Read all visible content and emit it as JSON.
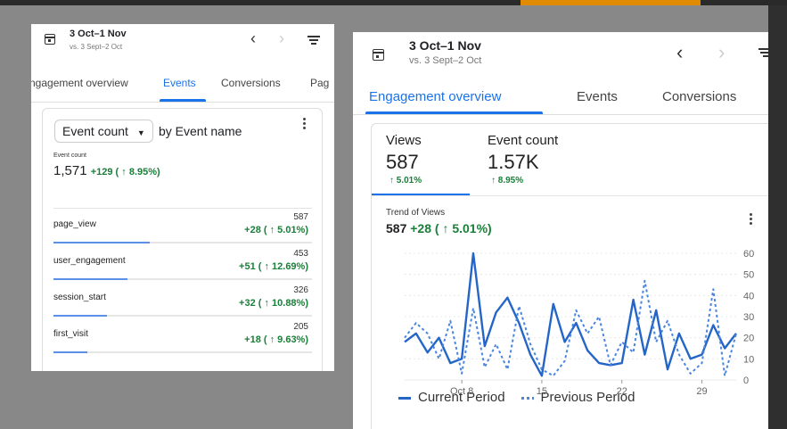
{
  "left_panel": {
    "header": {
      "date_range": "3 Oct–1 Nov",
      "comparison": "vs. 3 Sept–2 Oct",
      "prev_icon": "‹",
      "next_icon": "›"
    },
    "tabs": [
      {
        "label": "ngagement overview",
        "active": false
      },
      {
        "label": "Events",
        "active": true
      },
      {
        "label": "Conversions",
        "active": false
      },
      {
        "label": "Pag",
        "active": false
      }
    ],
    "card": {
      "metric_selector": "Event count",
      "dimension_label": "by Event name",
      "metric_label": "Event count",
      "total_value": "1,571",
      "total_delta": "+129 ( ↑ 8.95%)",
      "rows": [
        {
          "name": "page_view",
          "value": "587",
          "delta": "+28 ( ↑ 5.01%)",
          "share": 1.0
        },
        {
          "name": "user_engagement",
          "value": "453",
          "delta": "+51 ( ↑ 12.69%)",
          "share": 0.77
        },
        {
          "name": "session_start",
          "value": "326",
          "delta": "+32 ( ↑ 10.88%)",
          "share": 0.56
        },
        {
          "name": "first_visit",
          "value": "205",
          "delta": "+18 ( ↑ 9.63%)",
          "share": 0.35
        }
      ]
    }
  },
  "right_panel": {
    "header": {
      "date_range": "3 Oct–1 Nov",
      "comparison": "vs. 3 Sept–2 Oct",
      "prev_icon": "‹",
      "next_icon": "›"
    },
    "tabs": [
      {
        "label": "Engagement overview",
        "active": true
      },
      {
        "label": "Events",
        "active": false
      },
      {
        "label": "Conversions",
        "active": false
      }
    ],
    "metrics": [
      {
        "label": "Views",
        "value": "587",
        "delta": "↑ 5.01%",
        "selected": true
      },
      {
        "label": "Event count",
        "value": "1.57K",
        "delta": "↑ 8.95%",
        "selected": false
      }
    ],
    "trend": {
      "title": "Trend of Views",
      "value": "587",
      "delta": "+28 ( ↑ 5.01%)"
    },
    "legend": {
      "current": "Current Period",
      "previous": "Previous Period"
    }
  },
  "colors": {
    "accent": "#1a73e8",
    "positive": "#188038",
    "current_series": "#2466c8",
    "previous_series": "#4a86e0"
  },
  "chart_data": {
    "type": "line",
    "x_ticks": [
      "Oct 8",
      "15",
      "22",
      "29"
    ],
    "y_ticks": [
      0,
      10,
      20,
      30,
      40,
      50,
      60
    ],
    "ylim": [
      0,
      60
    ],
    "grid": true,
    "legend_position": "bottom",
    "series": [
      {
        "name": "Current Period",
        "style": "solid",
        "values": [
          18,
          22,
          13,
          20,
          8,
          10,
          60,
          16,
          32,
          39,
          27,
          12,
          2,
          36,
          18,
          27,
          14,
          8,
          7,
          8,
          38,
          12,
          33,
          5,
          22,
          10,
          12,
          26,
          15,
          22
        ]
      },
      {
        "name": "Previous Period",
        "style": "dashed",
        "values": [
          20,
          27,
          22,
          10,
          28,
          3,
          34,
          6,
          17,
          5,
          35,
          17,
          5,
          2,
          9,
          33,
          22,
          30,
          7,
          18,
          13,
          47,
          18,
          28,
          12,
          3,
          8,
          43,
          2,
          22
        ]
      }
    ]
  }
}
